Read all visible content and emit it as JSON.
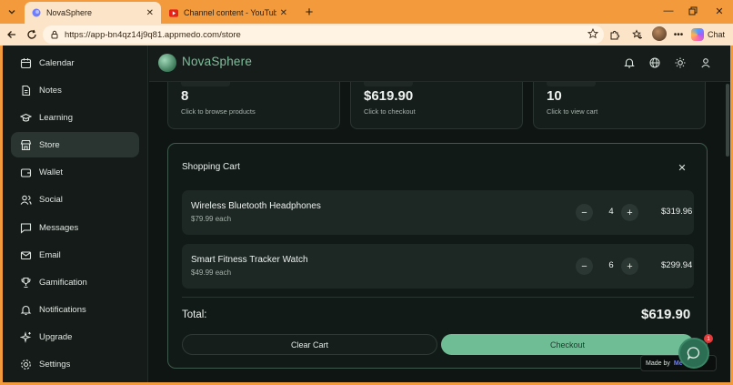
{
  "browser": {
    "tabs": [
      {
        "title": "NovaSphere",
        "active": true
      },
      {
        "title": "Channel content - YouTube Studio",
        "active": false
      }
    ],
    "url": "https://app-bn4qz14j9q81.appmedo.com/store",
    "copilot_label": "Chat"
  },
  "app": {
    "brand": "NovaSphere",
    "sidebar": {
      "items": [
        {
          "label": "Calendar",
          "icon": "calendar-icon"
        },
        {
          "label": "Notes",
          "icon": "notes-icon"
        },
        {
          "label": "Learning",
          "icon": "graduation-cap-icon"
        },
        {
          "label": "Store",
          "icon": "store-icon",
          "active": true
        },
        {
          "label": "Wallet",
          "icon": "wallet-icon"
        },
        {
          "label": "Social",
          "icon": "users-icon"
        },
        {
          "label": "Messages",
          "icon": "message-icon"
        },
        {
          "label": "Email",
          "icon": "mail-icon"
        },
        {
          "label": "Gamification",
          "icon": "trophy-icon"
        },
        {
          "label": "Notifications",
          "icon": "bell-icon"
        },
        {
          "label": "Upgrade",
          "icon": "sparkles-icon"
        },
        {
          "label": "Settings",
          "icon": "gear-icon"
        }
      ]
    },
    "stats": [
      {
        "value": "8",
        "hint": "Click to browse products"
      },
      {
        "value": "$619.90",
        "hint": "Click to checkout"
      },
      {
        "value": "10",
        "hint": "Click to view cart"
      }
    ],
    "cart": {
      "title": "Shopping Cart",
      "items": [
        {
          "name": "Wireless Bluetooth Headphones",
          "unit_price": "$79.99 each",
          "quantity": "4",
          "line_total": "$319.96"
        },
        {
          "name": "Smart Fitness Tracker Watch",
          "unit_price": "$49.99 each",
          "quantity": "6",
          "line_total": "$299.94"
        }
      ],
      "total_label": "Total:",
      "total_value": "$619.90",
      "clear_label": "Clear Cart",
      "checkout_label": "Checkout"
    },
    "made_by_label": "Made by",
    "made_by_brand": "Me",
    "chat_badge": "1"
  },
  "colors": {
    "accent": "#6fbd95",
    "brand": "#7fbf9c",
    "browser_frame": "#f39a3c",
    "badge": "#e23b3b"
  }
}
